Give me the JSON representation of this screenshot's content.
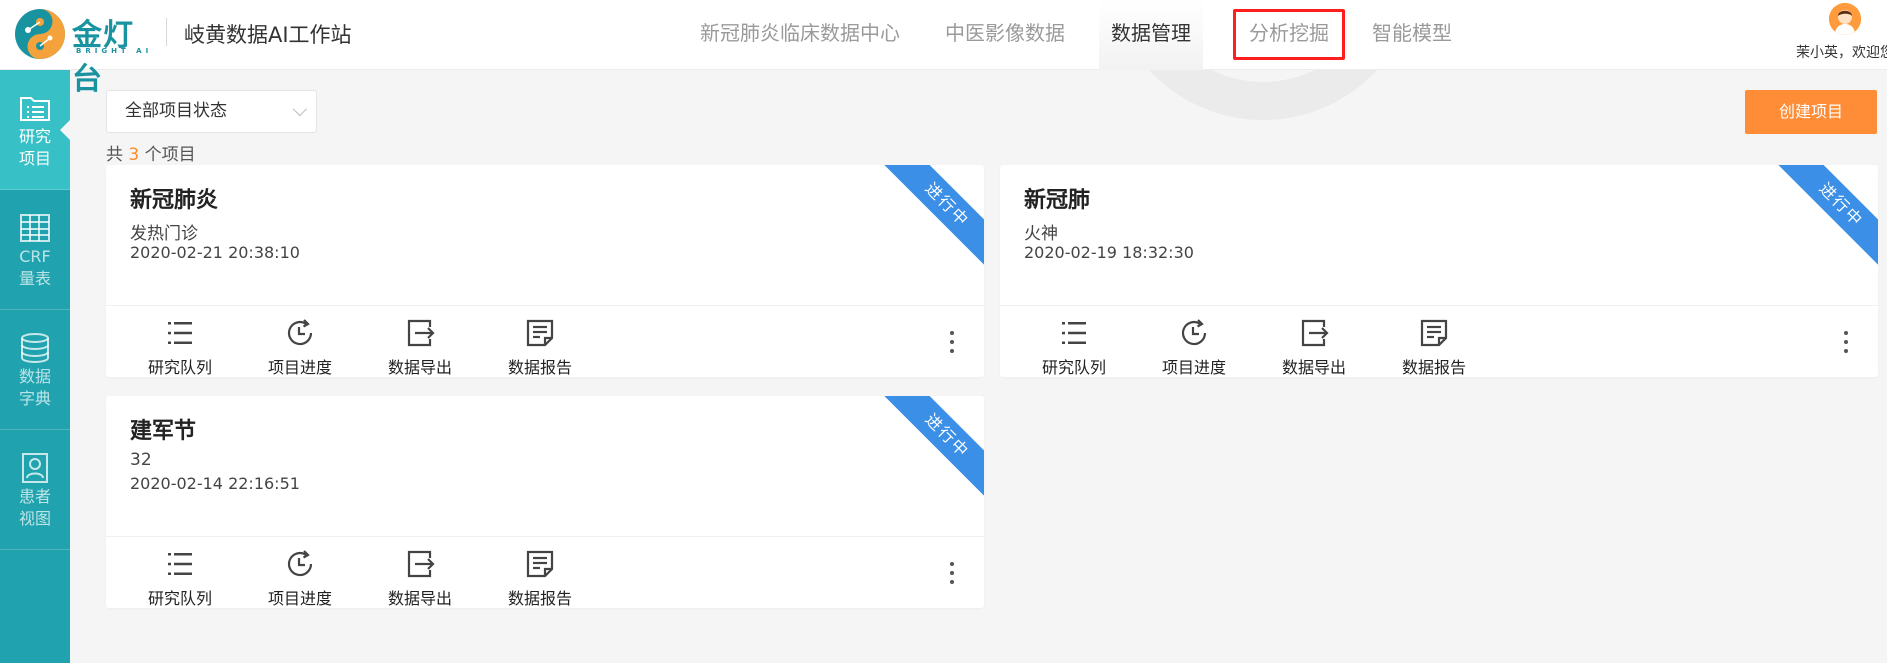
{
  "header": {
    "logo_text": "金灯台",
    "logo_sub": "BRIGHT AI",
    "app_title": "岐黄数据AI工作站",
    "nav": [
      {
        "label": "新冠肺炎临床数据中心"
      },
      {
        "label": "中医影像数据"
      },
      {
        "label": "数据管理",
        "active": true
      },
      {
        "label": "分析挖掘",
        "highlighted": true
      },
      {
        "label": "智能模型"
      }
    ],
    "user_name": "茉小英，欢迎您"
  },
  "sidebar": {
    "items": [
      {
        "label_line1": "研究",
        "label_line2": "项目",
        "icon": "folder-list-icon",
        "active": true
      },
      {
        "label_line1": "CRF",
        "label_line2": "量表",
        "icon": "table-grid-icon"
      },
      {
        "label_line1": "数据",
        "label_line2": "字典",
        "icon": "database-icon"
      },
      {
        "label_line1": "患者",
        "label_line2": "视图",
        "icon": "patient-card-icon"
      }
    ]
  },
  "toolbar": {
    "status_filter": "全部项目状态",
    "count_prefix": "共",
    "count_value": "3",
    "count_suffix": "个项目",
    "create_label": "创建项目"
  },
  "projects": [
    {
      "title": "新冠肺炎",
      "desc": "发热门诊",
      "date": "2020-02-21 20:38:10",
      "status": "进行中"
    },
    {
      "title": "新冠肺",
      "desc": "火神",
      "date": "2020-02-19 18:32:30",
      "status": "进行中"
    },
    {
      "title": "建军节",
      "desc": "32",
      "date": "2020-02-14 22:16:51",
      "status": "进行中"
    }
  ],
  "card_actions": [
    "研究队列",
    "项目进度",
    "数据导出",
    "数据报告"
  ],
  "colors": {
    "sidebar": "#20a3ae",
    "sidebar_active": "#37c0c6",
    "accent_orange": "#ff8c36",
    "ribbon_blue": "#3b8fe6",
    "highlight_red": "#ff1d1d"
  }
}
